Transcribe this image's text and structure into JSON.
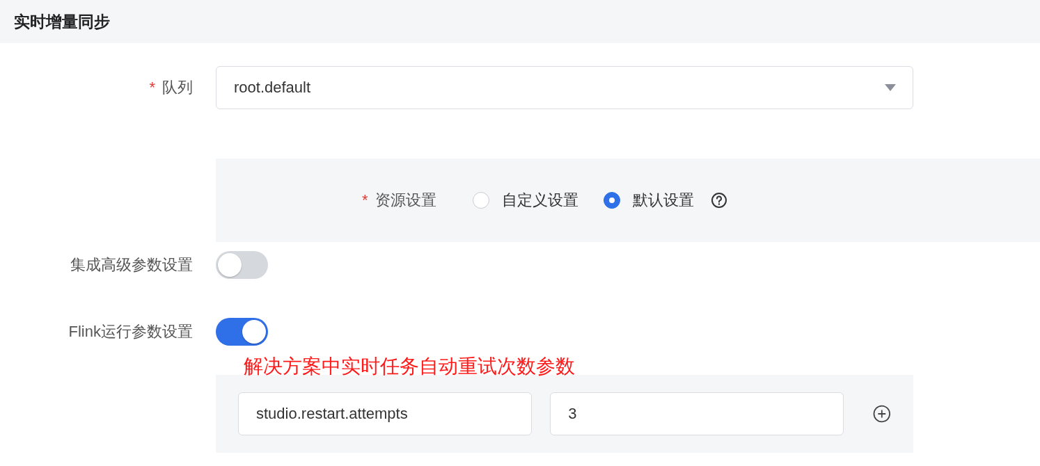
{
  "header": {
    "title": "实时增量同步"
  },
  "queue": {
    "required_mark": "*",
    "label": "队列",
    "value": "root.default"
  },
  "resource": {
    "required_mark": "*",
    "label": "资源设置",
    "options": [
      {
        "label": "自定义设置",
        "selected": false,
        "help": false
      },
      {
        "label": "默认设置",
        "selected": true,
        "help": true
      }
    ]
  },
  "switches": [
    {
      "label": "集成高级参数设置",
      "on": false
    },
    {
      "label": "Flink运行参数设置",
      "on": true
    }
  ],
  "annotation": "解决方案中实时任务自动重试次数参数",
  "params": [
    {
      "key": "studio.restart.attempts",
      "value": "3"
    }
  ]
}
